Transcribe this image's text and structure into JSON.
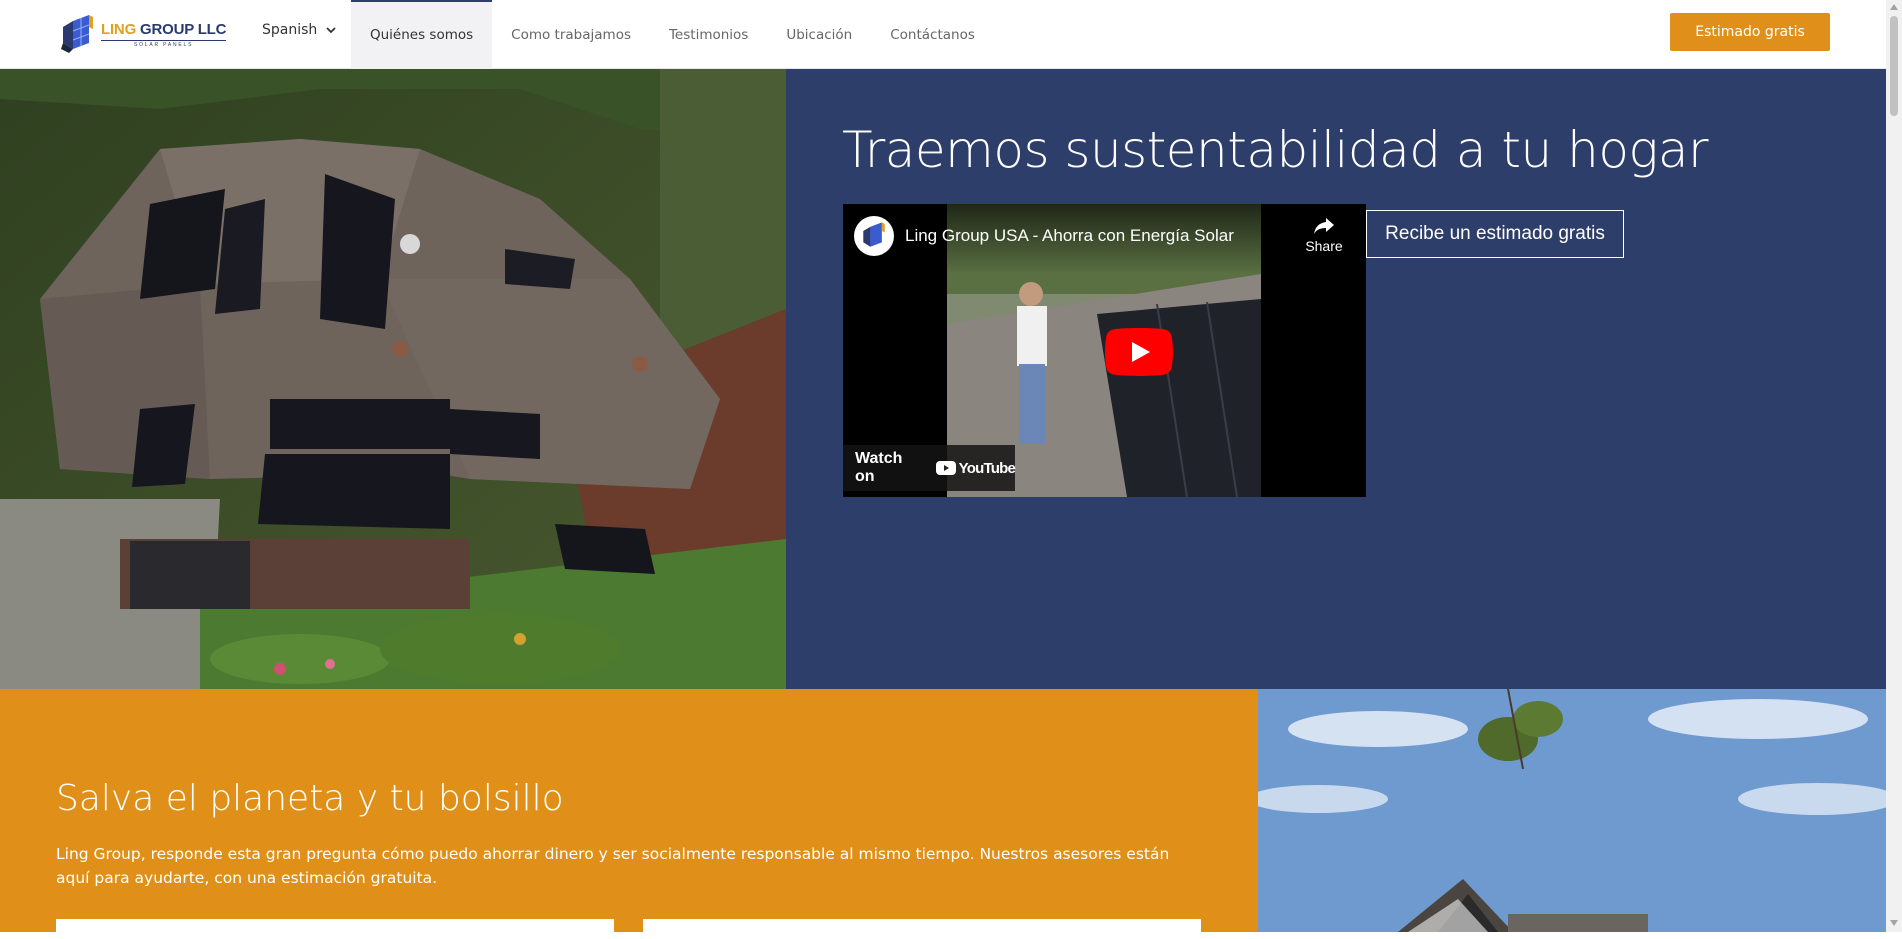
{
  "header": {
    "logo": {
      "name_part1": "LING",
      "name_part2": "GROUP LLC",
      "tagline": "SOLAR PANELS"
    },
    "language": {
      "selected": "Spanish"
    },
    "nav_items": [
      {
        "label": "Quiénes somos",
        "active": true
      },
      {
        "label": "Como trabajamos",
        "active": false
      },
      {
        "label": "Testimonios",
        "active": false
      },
      {
        "label": "Ubicación",
        "active": false
      },
      {
        "label": "Contáctanos",
        "active": false
      }
    ],
    "cta_label": "Estimado gratis"
  },
  "hero": {
    "title": "Traemos sustentabilidad a tu hogar",
    "video": {
      "title": "Ling Group USA - Ahorra con Energía Solar",
      "share_label": "Share",
      "watch_on_label": "Watch on",
      "platform": "YouTube"
    },
    "estimate_button": "Recibe un estimado gratis"
  },
  "section2": {
    "title": "Salva el planeta y tu bolsillo",
    "text": "Ling Group, responde esta gran pregunta cómo puedo ahorrar dinero y ser socialmente responsable al mismo tiempo. Nuestros asesores están aquí para ayudarte, con una estimación gratuita."
  },
  "colors": {
    "navy": "#2e3e6a",
    "orange": "#e0901a",
    "gold": "#e0a020"
  },
  "icons": {
    "language": "chevron-down-icon",
    "share": "share-arrow-icon",
    "play": "youtube-play-icon"
  }
}
